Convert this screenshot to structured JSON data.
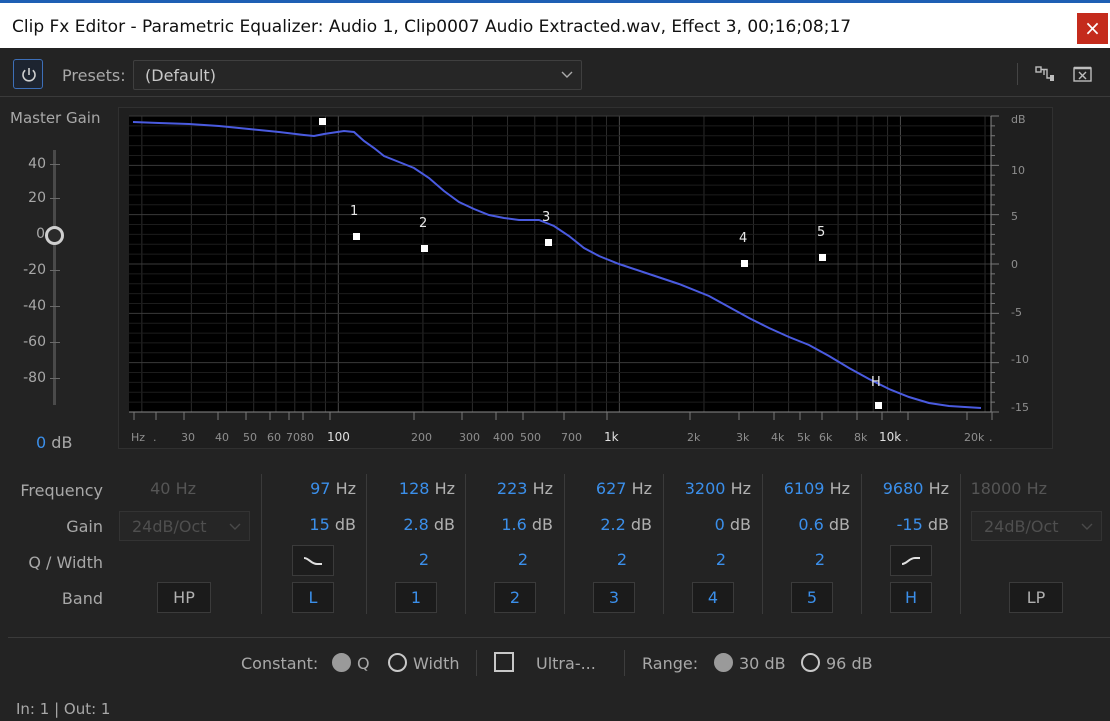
{
  "window": {
    "title": "Clip Fx Editor - Parametric Equalizer: Audio 1, Clip0007 Audio Extracted.wav, Effect 3, 00;16;08;17",
    "close_glyph": "×"
  },
  "toolbar": {
    "presets_label": "Presets:",
    "presets_value": "(Default)",
    "power_icon": "power-icon",
    "route_icon": "routing-icon",
    "remove_icon": "remove-effect-icon"
  },
  "master_gain": {
    "label": "Master Gain",
    "ticks": [
      "40",
      "20",
      "0",
      "-20",
      "-40",
      "-60",
      "-80"
    ],
    "value": "0",
    "unit": "dB"
  },
  "graph": {
    "x_ticks": [
      "Hz",
      ".",
      "30",
      "40",
      "50",
      "60",
      "70",
      "80",
      "100",
      "200",
      "300",
      "400",
      "500",
      "700",
      "1k",
      "2k",
      "3k",
      "4k",
      "5k",
      "6k",
      "8k",
      "10k",
      ".",
      "20k",
      "."
    ],
    "y_ticks": [
      "dB",
      "10",
      "5",
      "0",
      "-5",
      "-10",
      "-15"
    ],
    "band_labels": [
      "1",
      "2",
      "3",
      "4",
      "5",
      "H"
    ],
    "curve_color": "#4a5be0"
  },
  "rows": {
    "frequency": "Frequency",
    "gain": "Gain",
    "q_width": "Q / Width",
    "band": "Band"
  },
  "bands": {
    "hp": {
      "freq": "40",
      "unit": "Hz",
      "slope": "24dB/Oct",
      "button": "HP"
    },
    "l": {
      "freq": "97",
      "unit": "Hz",
      "gain": "15",
      "gain_unit": "dB",
      "button": "L",
      "shape_icon": "low-shelf-icon"
    },
    "b1": {
      "freq": "128",
      "unit": "Hz",
      "gain": "2.8",
      "gain_unit": "dB",
      "q": "2",
      "button": "1"
    },
    "b2": {
      "freq": "223",
      "unit": "Hz",
      "gain": "1.6",
      "gain_unit": "dB",
      "q": "2",
      "button": "2"
    },
    "b3": {
      "freq": "627",
      "unit": "Hz",
      "gain": "2.2",
      "gain_unit": "dB",
      "q": "2",
      "button": "3"
    },
    "b4": {
      "freq": "3200",
      "unit": "Hz",
      "gain": "0",
      "gain_unit": "dB",
      "q": "2",
      "button": "4"
    },
    "b5": {
      "freq": "6109",
      "unit": "Hz",
      "gain": "0.6",
      "gain_unit": "dB",
      "q": "2",
      "button": "5"
    },
    "h": {
      "freq": "9680",
      "unit": "Hz",
      "gain": "-15",
      "gain_unit": "dB",
      "button": "H",
      "shape_icon": "high-shelf-icon"
    },
    "lp": {
      "freq": "18000",
      "unit": "Hz",
      "slope": "24dB/Oct",
      "button": "LP"
    }
  },
  "options": {
    "constant_label": "Constant:",
    "q_label": "Q",
    "width_label": "Width",
    "ultra_label": "Ultra-...",
    "range_label": "Range:",
    "range_30": "30 dB",
    "range_96": "96 dB",
    "constant_selected": "Q",
    "range_selected": "30 dB"
  },
  "status": "In: 1 | Out: 1",
  "accent_color": "#3b8fea"
}
